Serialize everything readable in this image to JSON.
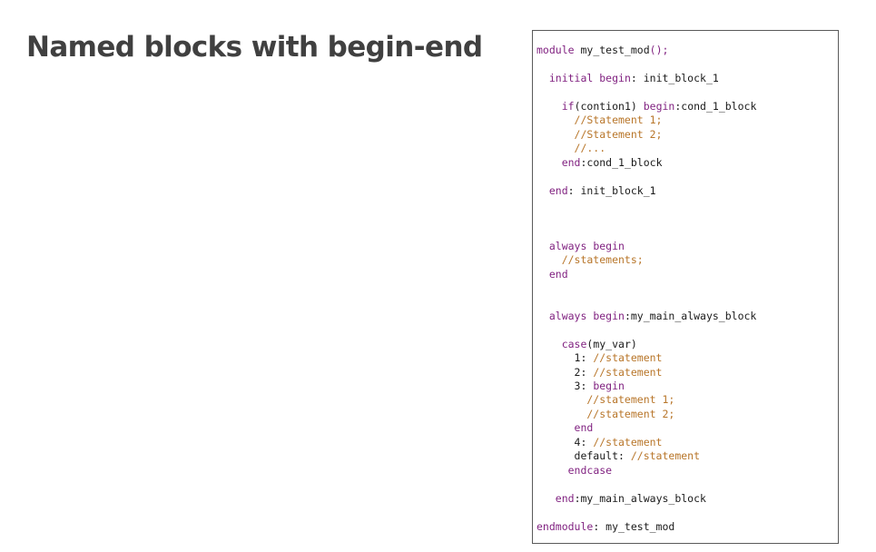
{
  "slide": {
    "title": "Named blocks with begin-end"
  },
  "colors": {
    "keyword": "#7f1f7f",
    "comment": "#b8762a",
    "identifier": "#1a1a1a",
    "title": "#404040",
    "panel_border": "#5a5a5a"
  },
  "code": {
    "lines": [
      [
        {
          "t": "module",
          "c": "kw"
        },
        {
          "t": " my_test_mod",
          "c": "id"
        },
        {
          "t": "();",
          "c": "kw"
        }
      ],
      [
        {
          "t": "  ",
          "c": "id"
        },
        {
          "t": "initial begin",
          "c": "kw"
        },
        {
          "t": ": init_block_1",
          "c": "id"
        }
      ],
      [
        {
          "t": "    ",
          "c": "id"
        },
        {
          "t": "if",
          "c": "kw"
        },
        {
          "t": "(contion1) ",
          "c": "id"
        },
        {
          "t": "begin",
          "c": "kw"
        },
        {
          "t": ":cond_1_block",
          "c": "id"
        }
      ],
      [
        {
          "t": "      //Statement 1;",
          "c": "cm"
        }
      ],
      [
        {
          "t": "      //Statement 2;",
          "c": "cm"
        }
      ],
      [
        {
          "t": "      //...",
          "c": "cm"
        }
      ],
      [
        {
          "t": "    ",
          "c": "id"
        },
        {
          "t": "end",
          "c": "kw"
        },
        {
          "t": ":cond_1_block",
          "c": "id"
        }
      ],
      [
        {
          "t": "  ",
          "c": "id"
        },
        {
          "t": "end",
          "c": "kw"
        },
        {
          "t": ": init_block_1",
          "c": "id"
        }
      ],
      [
        {
          "t": "  ",
          "c": "id"
        },
        {
          "t": "always begin",
          "c": "kw"
        }
      ],
      [
        {
          "t": "    //statements;",
          "c": "cm"
        }
      ],
      [
        {
          "t": "  ",
          "c": "id"
        },
        {
          "t": "end",
          "c": "kw"
        }
      ],
      [
        {
          "t": "  ",
          "c": "id"
        },
        {
          "t": "always begin",
          "c": "kw"
        },
        {
          "t": ":my_main_always_block",
          "c": "id"
        }
      ],
      [
        {
          "t": "    ",
          "c": "id"
        },
        {
          "t": "case",
          "c": "kw"
        },
        {
          "t": "(my_var)",
          "c": "id"
        }
      ],
      [
        {
          "t": "      1: ",
          "c": "id"
        },
        {
          "t": "//statement",
          "c": "cm"
        }
      ],
      [
        {
          "t": "      2: ",
          "c": "id"
        },
        {
          "t": "//statement",
          "c": "cm"
        }
      ],
      [
        {
          "t": "      3: ",
          "c": "id"
        },
        {
          "t": "begin",
          "c": "kw"
        }
      ],
      [
        {
          "t": "        //statement 1;",
          "c": "cm"
        }
      ],
      [
        {
          "t": "        //statement 2;",
          "c": "cm"
        }
      ],
      [
        {
          "t": "      ",
          "c": "id"
        },
        {
          "t": "end",
          "c": "kw"
        }
      ],
      [
        {
          "t": "      4: ",
          "c": "id"
        },
        {
          "t": "//statement",
          "c": "cm"
        }
      ],
      [
        {
          "t": "      default: ",
          "c": "id"
        },
        {
          "t": "//statement",
          "c": "cm"
        }
      ],
      [
        {
          "t": "     ",
          "c": "id"
        },
        {
          "t": "endcase",
          "c": "kw"
        }
      ],
      [
        {
          "t": "   ",
          "c": "id"
        },
        {
          "t": "end",
          "c": "kw"
        },
        {
          "t": ":my_main_always_block",
          "c": "id"
        }
      ],
      [
        {
          "t": "endmodule",
          "c": "kw"
        },
        {
          "t": ": my_test_mod",
          "c": "id"
        }
      ]
    ]
  }
}
